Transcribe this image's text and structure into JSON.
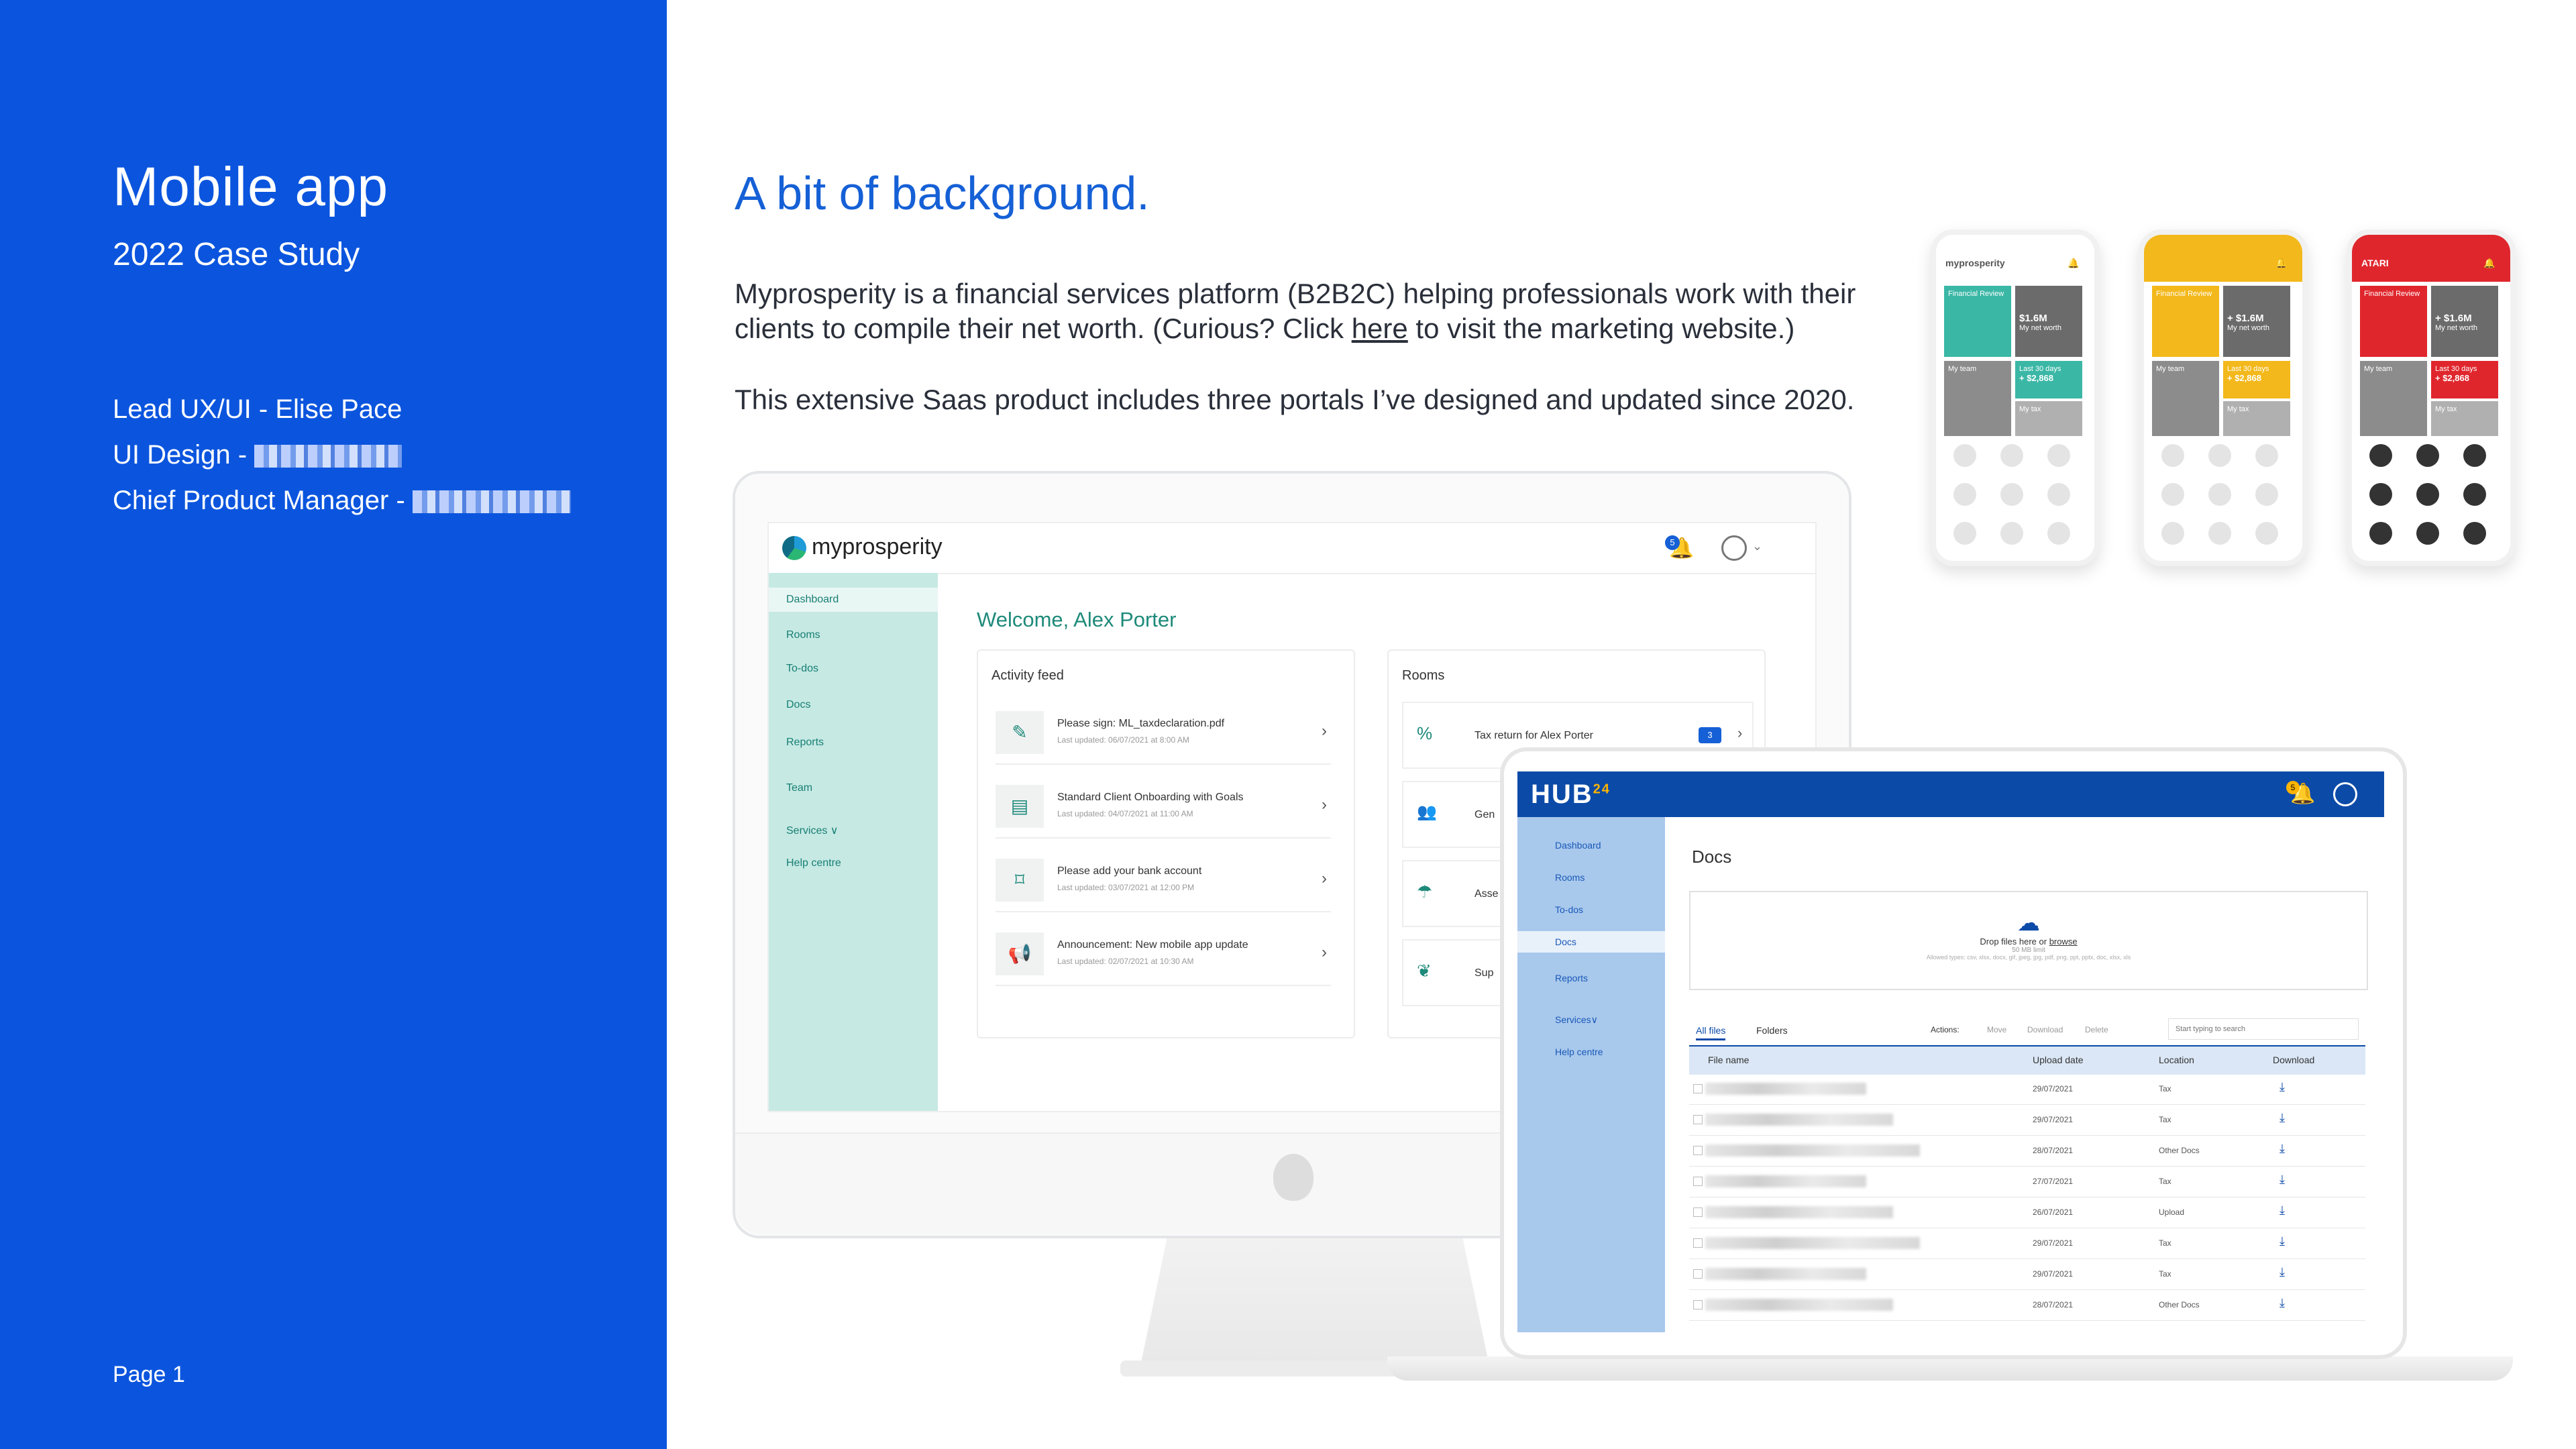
{
  "left_panel": {
    "title": "Mobile app",
    "subtitle": "2022 Case Study",
    "credits": [
      {
        "label": "Lead UX/UI - Elise Pace"
      },
      {
        "label": "UI Design - "
      },
      {
        "label": "Chief Product Manager - "
      }
    ],
    "page": "Page 1"
  },
  "main": {
    "headline": "A bit of background.",
    "para1_a": "Myprosperity is a financial services platform (B2B2C) helping professionals work with their",
    "para1_b": "clients to compile their net worth. (Curious? Click ",
    "para1_link": "here",
    "para1_c": " to visit the marketing website.)",
    "para2": "This extensive Saas product includes three portals I’ve designed and updated since 2020."
  },
  "myprosperity": {
    "logo": "myprosperity",
    "badge": "5",
    "nav": [
      "Dashboard",
      "Rooms",
      "To-dos",
      "Docs",
      "Reports",
      "Team",
      "Services ∨",
      "Help centre"
    ],
    "welcome": "Welcome, Alex Porter",
    "activity_title": "Activity feed",
    "activity": [
      {
        "title": "Please sign: ML_taxdeclaration.pdf",
        "sub": "Last updated: 06/07/2021 at 8:00 AM"
      },
      {
        "title": "Standard Client Onboarding with Goals",
        "sub": "Last updated: 04/07/2021 at 11:00 AM"
      },
      {
        "title": "Please add your bank account",
        "sub": "Last updated: 03/07/2021 at 12:00 PM"
      },
      {
        "title": "Announcement: New mobile app update",
        "sub": "Last updated: 02/07/2021 at 10:30 AM"
      }
    ],
    "rooms_title": "Rooms",
    "rooms": [
      {
        "label": "Tax return for Alex Porter",
        "badge": "3"
      },
      {
        "label": "Gen"
      },
      {
        "label": "Asse"
      },
      {
        "label": "Sup"
      }
    ]
  },
  "hub24": {
    "logo": "HUB",
    "logo_sup": "24",
    "badge": "5",
    "nav": [
      "Dashboard",
      "Rooms",
      "To-dos",
      "Docs",
      "Reports",
      "Services∨",
      "Help centre"
    ],
    "title": "Docs",
    "drop_text": "Drop files here or ",
    "drop_link": "browse",
    "drop_small": "50 MB limit",
    "drop_types": "Allowed types: csv, xlsx, docx, gif, jpeg, jpg, pdf, png, ppt, pptx, doc, xlsx, xls",
    "tabs": [
      "All files",
      "Folders"
    ],
    "actions": [
      "Actions:",
      "Move",
      "Download",
      "Delete"
    ],
    "search_placeholder": "Start typing to search",
    "columns": [
      "File name",
      "Upload date",
      "Location",
      "Download"
    ],
    "rows": [
      {
        "date": "29/07/2021",
        "location": "Tax"
      },
      {
        "date": "29/07/2021",
        "location": "Tax"
      },
      {
        "date": "28/07/2021",
        "location": "Other Docs"
      },
      {
        "date": "27/07/2021",
        "location": "Tax"
      },
      {
        "date": "26/07/2021",
        "location": "Upload"
      },
      {
        "date": "29/07/2021",
        "location": "Tax"
      },
      {
        "date": "29/07/2021",
        "location": "Tax"
      },
      {
        "date": "28/07/2021",
        "location": "Other Docs"
      }
    ]
  },
  "phones": [
    {
      "brand": "myprosperity",
      "accent": "#3bb7a6",
      "tile1": "Financial Review",
      "tile2": "$1.6M",
      "tile2_sub": "My net worth",
      "tile3": "My team",
      "tile4": "+ $2,868",
      "tile4_sub": "Last 30 days",
      "tile5": "My tax"
    },
    {
      "brand": "",
      "accent": "#f3b81b",
      "tile1": "Financial Review",
      "tile2": "+ $1.6M",
      "tile2_sub": "My net worth",
      "tile3": "My team",
      "tile4": "+ $2,868",
      "tile4_sub": "Last 30 days",
      "tile5": "My tax"
    },
    {
      "brand": "ATARI",
      "accent": "#e0262d",
      "tile1": "Financial Review",
      "tile2": "+ $1.6M",
      "tile2_sub": "My net worth",
      "tile3": "My team",
      "tile4": "+ $2,868",
      "tile4_sub": "Last 30 days",
      "tile5": "My tax"
    }
  ],
  "colors": {
    "brand_blue": "#0b55de",
    "headline_blue": "#1560d6",
    "mp_teal": "#c6e9e3",
    "hub_navy": "#0c4aa8"
  }
}
